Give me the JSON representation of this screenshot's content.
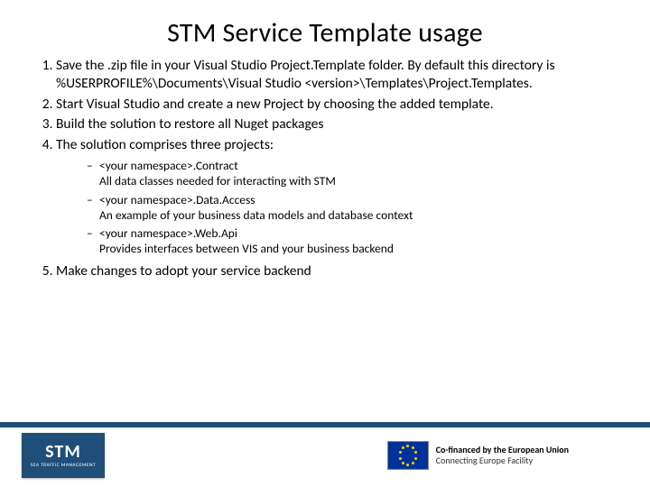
{
  "title": "STM Service Template usage",
  "items": [
    "Save the .zip file in your Visual Studio Project.Template folder. By default this directory is %USERPROFILE%\\Documents\\Visual Studio <version>\\Templates\\Project.Templates.",
    "Start Visual Studio and create a new Project by choosing the added template.",
    "Build the solution to restore all Nuget packages",
    "The solution comprises three projects:"
  ],
  "subitems": [
    {
      "head": "<your namespace>.Contract",
      "desc": "All data classes needed for interacting with STM"
    },
    {
      "head": "<your namespace>.Data.Access",
      "desc": "An example of your business data models and database context"
    },
    {
      "head": "<your namespace>.Web.Api",
      "desc": "Provides interfaces between VIS and your business backend"
    }
  ],
  "item5": "Make changes to adopt your service backend",
  "logo": {
    "main": "STM",
    "sub": "SEA TRAFFIC MANAGEMENT"
  },
  "eu": {
    "l1": "Co-financed by the European Union",
    "l2": "Connecting Europe Facility"
  }
}
